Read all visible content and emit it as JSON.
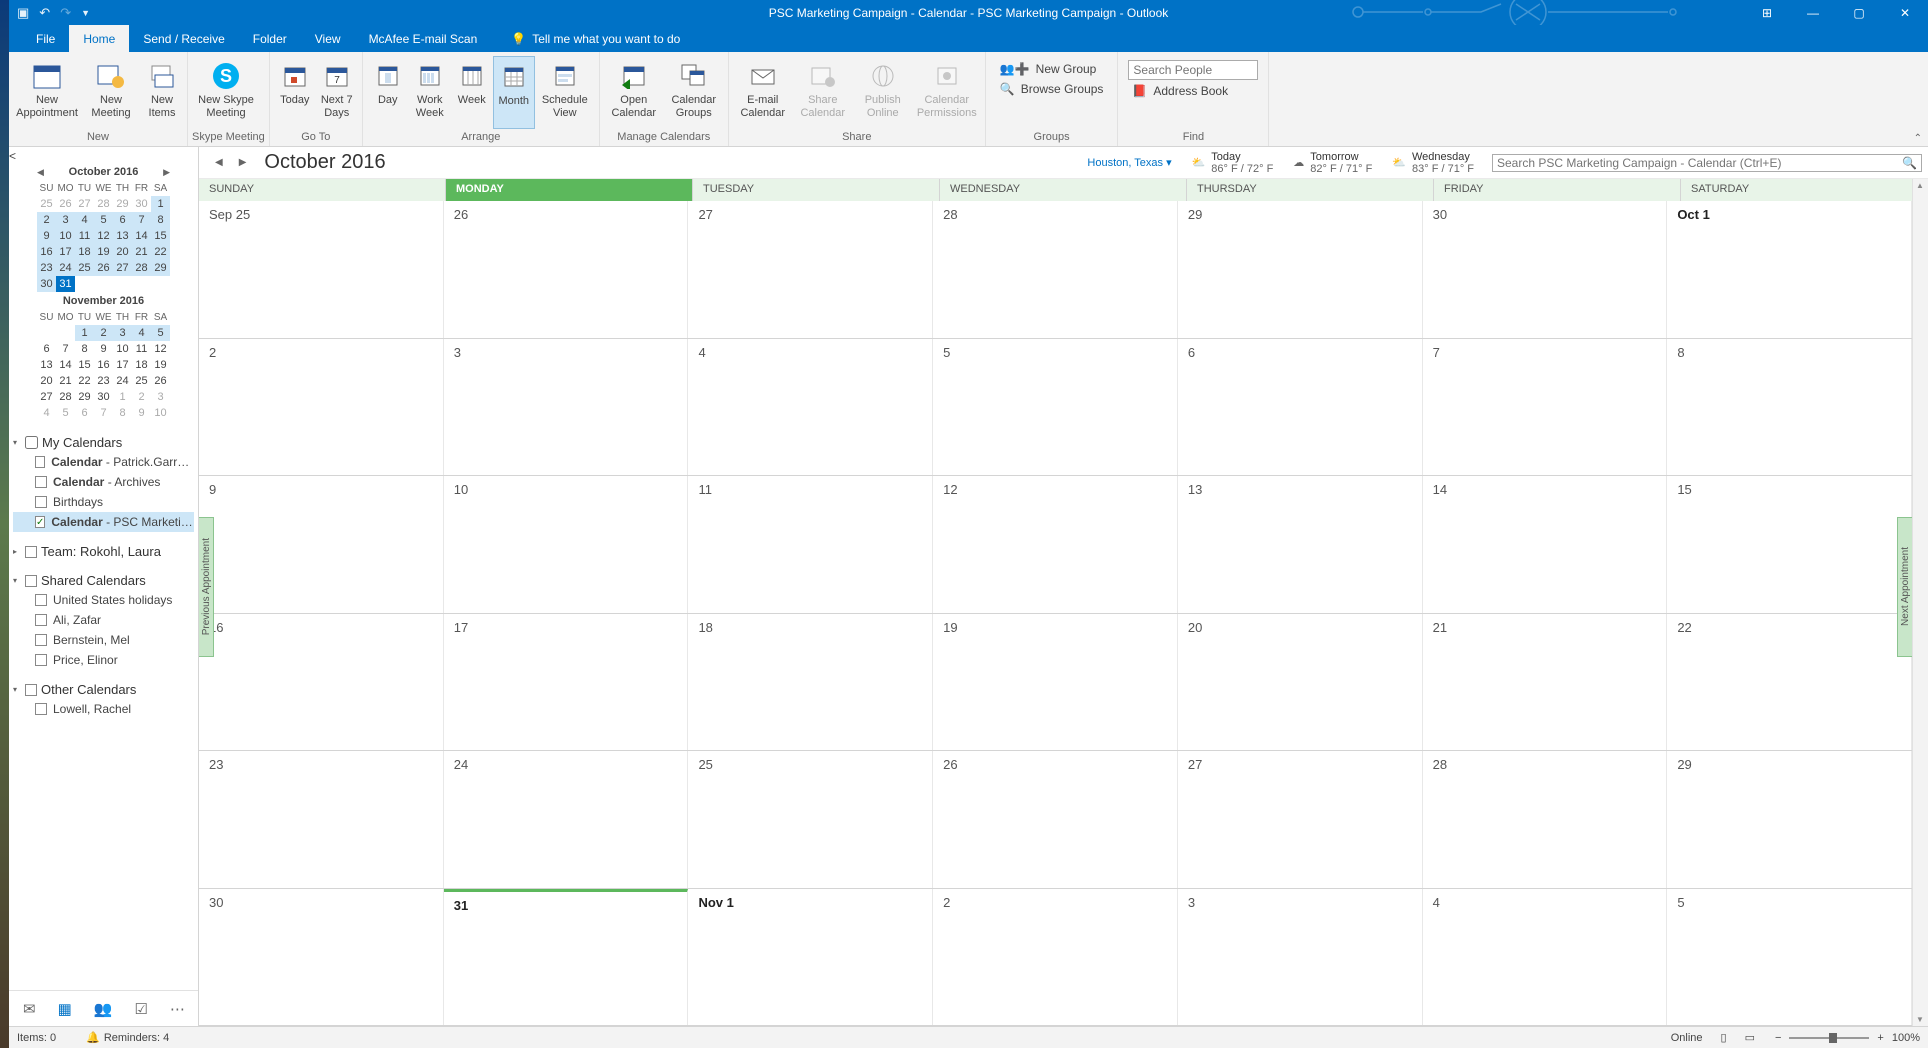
{
  "window": {
    "title": "PSC Marketing Campaign - Calendar - PSC Marketing Campaign - Outlook"
  },
  "tabs": {
    "file": "File",
    "home": "Home",
    "send": "Send / Receive",
    "folder": "Folder",
    "view": "View",
    "mcafee": "McAfee E-mail Scan",
    "tell": "Tell me what you want to do"
  },
  "ribbon": {
    "new_appt": "New\nAppointment",
    "new_meeting": "New\nMeeting",
    "new_items": "New\nItems",
    "new_label": "New",
    "skype": "New Skype\nMeeting",
    "skype_label": "Skype Meeting",
    "today": "Today",
    "next7": "Next 7\nDays",
    "goto_label": "Go To",
    "day": "Day",
    "work_week": "Work\nWeek",
    "week": "Week",
    "month": "Month",
    "schedule": "Schedule\nView",
    "arrange_label": "Arrange",
    "open_cal": "Open\nCalendar",
    "cal_groups": "Calendar\nGroups",
    "manage_label": "Manage Calendars",
    "email_cal": "E-mail\nCalendar",
    "share_cal": "Share\nCalendar",
    "publish": "Publish\nOnline",
    "cal_perms": "Calendar\nPermissions",
    "share_label": "Share",
    "new_group": "New Group",
    "browse_groups": "Browse Groups",
    "groups_label": "Groups",
    "search_people_ph": "Search People",
    "address_book": "Address Book",
    "find_label": "Find"
  },
  "minical1": {
    "title": "October 2016",
    "dow": [
      "SU",
      "MO",
      "TU",
      "WE",
      "TH",
      "FR",
      "SA"
    ],
    "rows": [
      [
        "25",
        "26",
        "27",
        "28",
        "29",
        "30",
        "1"
      ],
      [
        "2",
        "3",
        "4",
        "5",
        "6",
        "7",
        "8"
      ],
      [
        "9",
        "10",
        "11",
        "12",
        "13",
        "14",
        "15"
      ],
      [
        "16",
        "17",
        "18",
        "19",
        "20",
        "21",
        "22"
      ],
      [
        "23",
        "24",
        "25",
        "26",
        "27",
        "28",
        "29"
      ],
      [
        "30",
        "31",
        "",
        "",
        "",
        "",
        ""
      ]
    ]
  },
  "minical2": {
    "title": "November 2016",
    "rows": [
      [
        "",
        "",
        "1",
        "2",
        "3",
        "4",
        "5"
      ],
      [
        "6",
        "7",
        "8",
        "9",
        "10",
        "11",
        "12"
      ],
      [
        "13",
        "14",
        "15",
        "16",
        "17",
        "18",
        "19"
      ],
      [
        "20",
        "21",
        "22",
        "23",
        "24",
        "25",
        "26"
      ],
      [
        "27",
        "28",
        "29",
        "30",
        "1",
        "2",
        "3"
      ],
      [
        "4",
        "5",
        "6",
        "7",
        "8",
        "9",
        "10"
      ]
    ]
  },
  "tree": {
    "my_cal": "My Calendars",
    "cal1_a": "Calendar",
    "cal1_b": " - Patrick.Garrett@as...",
    "cal2_a": "Calendar",
    "cal2_b": " - Archives",
    "cal3": "Birthdays",
    "cal4_a": "Calendar",
    "cal4_b": " - PSC Marketing Ca...",
    "team": "Team: Rokohl, Laura",
    "shared": "Shared Calendars",
    "sh1": "United States holidays",
    "sh2": "Ali, Zafar",
    "sh3": "Bernstein, Mel",
    "sh4": "Price, Elinor",
    "other": "Other Calendars",
    "oth1": "Lowell, Rachel"
  },
  "main": {
    "month_title": "October 2016",
    "location": "Houston, Texas",
    "w1_d": "Today",
    "w1_t": "86° F / 72° F",
    "w2_d": "Tomorrow",
    "w2_t": "82° F / 71° F",
    "w3_d": "Wednesday",
    "w3_t": "83° F / 71° F",
    "search_ph": "Search PSC Marketing Campaign - Calendar (Ctrl+E)",
    "prev_handle": "Previous Appointment",
    "next_handle": "Next Appointment"
  },
  "dayheaders": [
    "SUNDAY",
    "MONDAY",
    "TUESDAY",
    "WEDNESDAY",
    "THURSDAY",
    "FRIDAY",
    "SATURDAY"
  ],
  "weeks": [
    [
      "Sep 25",
      "26",
      "27",
      "28",
      "29",
      "30",
      "Oct 1"
    ],
    [
      "2",
      "3",
      "4",
      "5",
      "6",
      "7",
      "8"
    ],
    [
      "9",
      "10",
      "11",
      "12",
      "13",
      "14",
      "15"
    ],
    [
      "16",
      "17",
      "18",
      "19",
      "20",
      "21",
      "22"
    ],
    [
      "23",
      "24",
      "25",
      "26",
      "27",
      "28",
      "29"
    ],
    [
      "30",
      "31",
      "Nov 1",
      "2",
      "3",
      "4",
      "5"
    ]
  ],
  "status": {
    "items": "Items: 0",
    "reminders": "Reminders: 4",
    "online": "Online",
    "zoom": "100%"
  }
}
